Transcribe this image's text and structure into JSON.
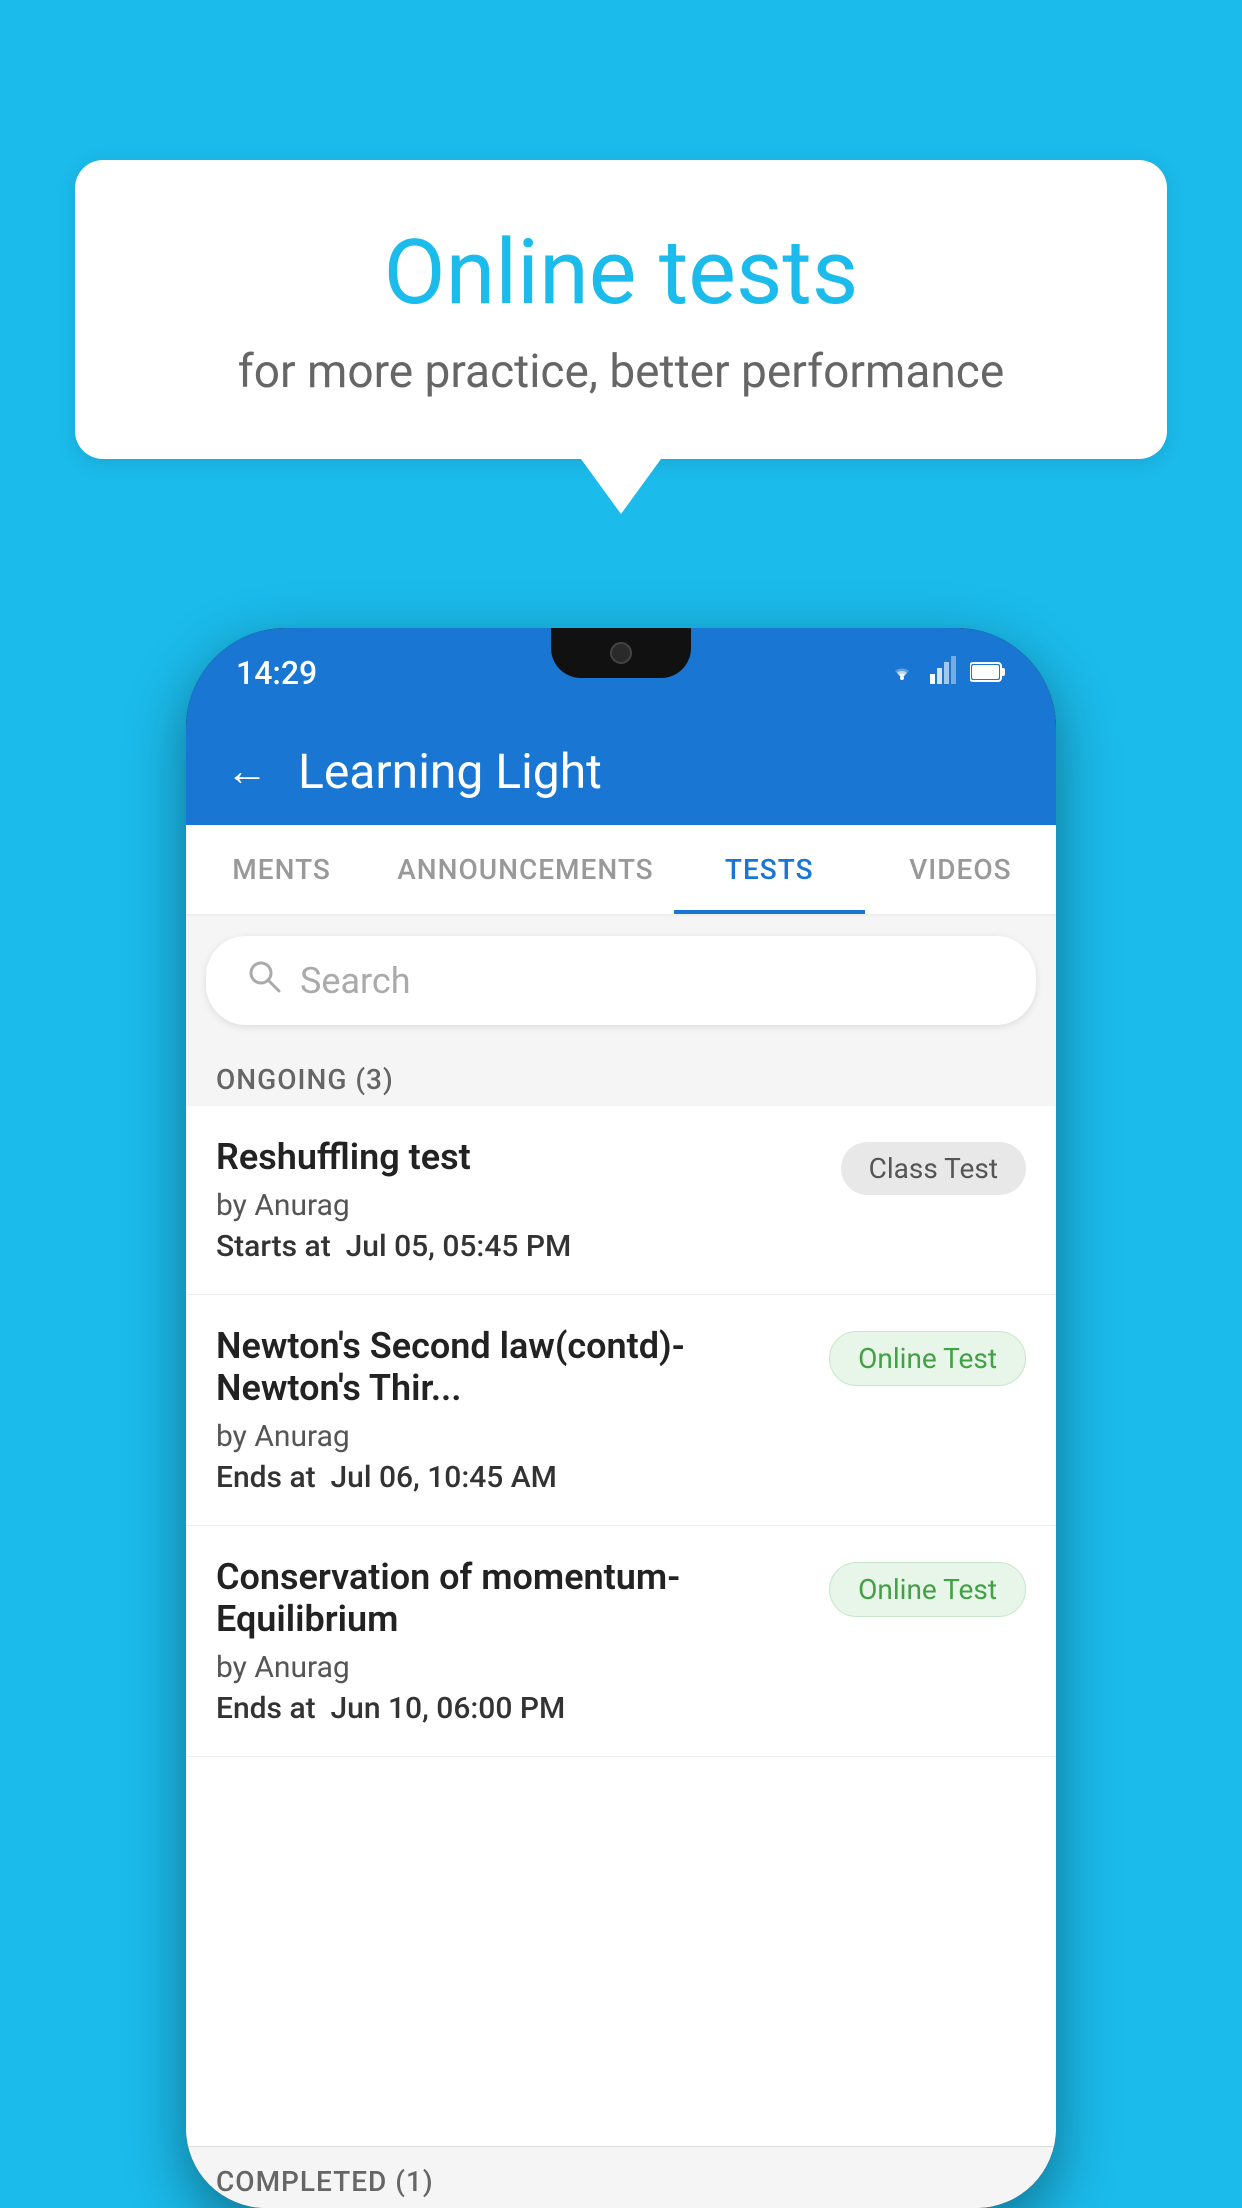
{
  "background_color": "#1BBBEB",
  "speech_bubble": {
    "title": "Online tests",
    "subtitle": "for more practice, better performance"
  },
  "phone": {
    "status_bar": {
      "time": "14:29",
      "icons": [
        "wifi",
        "signal",
        "battery"
      ]
    },
    "header": {
      "back_label": "←",
      "title": "Learning Light"
    },
    "tabs": [
      {
        "label": "MENTS",
        "active": false
      },
      {
        "label": "ANNOUNCEMENTS",
        "active": false
      },
      {
        "label": "TESTS",
        "active": true
      },
      {
        "label": "VIDEOS",
        "active": false
      }
    ],
    "search": {
      "placeholder": "Search"
    },
    "section_ongoing": "ONGOING (3)",
    "tests_ongoing": [
      {
        "name": "Reshuffling test",
        "author": "by Anurag",
        "time_label": "Starts at",
        "time_value": "Jul 05, 05:45 PM",
        "badge": "Class Test",
        "badge_type": "class"
      },
      {
        "name": "Newton's Second law(contd)-Newton's Thir...",
        "author": "by Anurag",
        "time_label": "Ends at",
        "time_value": "Jul 06, 10:45 AM",
        "badge": "Online Test",
        "badge_type": "online"
      },
      {
        "name": "Conservation of momentum-Equilibrium",
        "author": "by Anurag",
        "time_label": "Ends at",
        "time_value": "Jun 10, 06:00 PM",
        "badge": "Online Test",
        "badge_type": "online"
      }
    ],
    "section_completed": "COMPLETED (1)"
  }
}
